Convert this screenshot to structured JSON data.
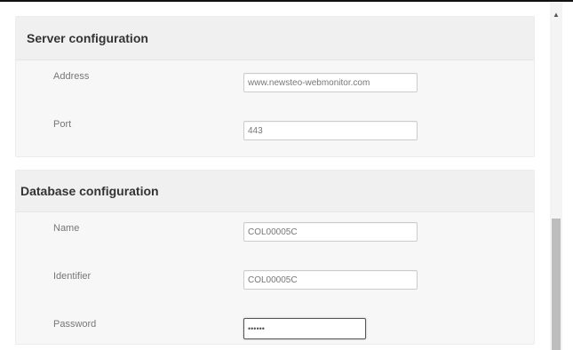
{
  "server": {
    "title": "Server configuration",
    "fields": [
      {
        "label": "Address",
        "value": "www.newsteo-webmonitor.com"
      },
      {
        "label": "Port",
        "value": "443"
      }
    ]
  },
  "database": {
    "title": "Database configuration",
    "fields": [
      {
        "label": "Name",
        "value": "COL00005C"
      },
      {
        "label": "Identifier",
        "value": "COL00005C"
      },
      {
        "label": "Password",
        "value": "••••••"
      }
    ]
  },
  "scrollbar": {
    "up_arrow_icon": "arrow-up-icon",
    "up_glyph": "▲"
  }
}
